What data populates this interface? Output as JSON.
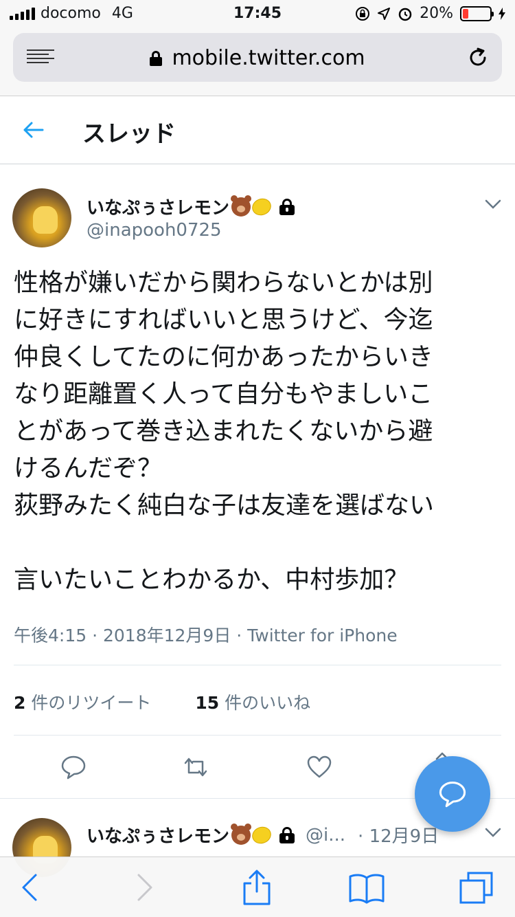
{
  "status_bar": {
    "carrier": "docomo",
    "network": "4G",
    "time": "17:45",
    "battery_percent": "20%",
    "battery_level": 0.2,
    "colors": {
      "battery_low": "#ff3b30"
    }
  },
  "browser": {
    "url": "mobile.twitter.com",
    "icons": [
      "menu-icon",
      "lock-icon",
      "reload-icon"
    ]
  },
  "header": {
    "title": "スレッド",
    "back_icon": "back-arrow-icon",
    "accent": "#1da1f2"
  },
  "tweet": {
    "display_name": "いなぷぅさレモン",
    "handle": "@inapooh0725",
    "badges": [
      "bear-emoji",
      "lemon-emoji",
      "lock-icon"
    ],
    "text": "性格が嫌いだから関わらないとかは別\nに好きにすればいいと思うけど、今迄\n仲良くしてたのに何かあったからいき\nなり距離置く人って自分もやましいこ\nとがあって巻き込まれたくないから避\nけるんだぞ？\n荻野みたく純白な子は友達を選ばない\n\n言いたいことわかるか、中村歩加？",
    "meta": "午後4:15 · 2018年12月9日 · Twitter for iPhone",
    "retweet_count": "2",
    "retweet_label": "件のリツイート",
    "like_count": "15",
    "like_label": "件のいいね",
    "actions": [
      "reply-icon",
      "retweet-icon",
      "like-icon",
      "share-icon"
    ]
  },
  "reply_preview": {
    "display_name": "いなぷぅさレモン",
    "handle": "@i...",
    "date": "· 12月9日"
  },
  "fab": {
    "icon": "compose-reply-icon",
    "color": "#4a99e9"
  },
  "toolbar": {
    "icons": [
      "back-icon",
      "forward-icon",
      "share-icon",
      "bookmarks-icon",
      "tabs-icon"
    ],
    "tint": "#1a7cf5"
  }
}
